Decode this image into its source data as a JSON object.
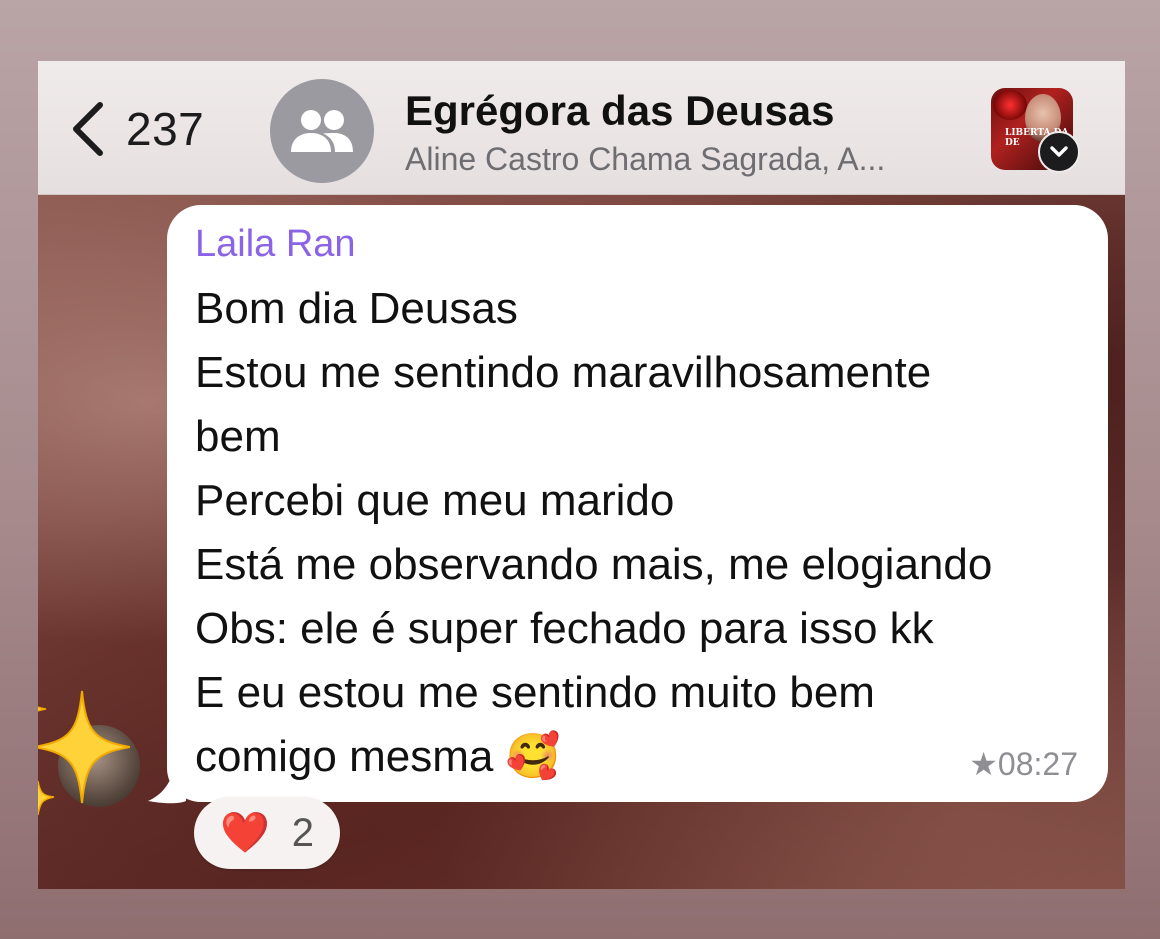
{
  "header": {
    "back_count": "237",
    "title": "Egrégora das Deusas",
    "subtitle": "Aline Castro Chama Sagrada, A...",
    "thumbnail_text": "LIBERTA DA DE"
  },
  "message": {
    "sender": "Laila Ran",
    "lines": [
      "Bom dia Deusas",
      "Estou me sentindo maravilhosamente",
      "bem",
      "Percebi que meu marido",
      "Está me observando mais, me elogiando",
      "Obs: ele é super fechado para isso kk",
      "E eu estou me sentindo muito bem",
      "comigo mesma 🥰"
    ],
    "time": "★08:27",
    "starred": true
  },
  "reaction": {
    "emoji": "❤️",
    "count": "2"
  },
  "colors": {
    "sender_name": "#8b63e6",
    "header_bg": "#ece6e6",
    "bubble_bg": "#ffffff"
  }
}
